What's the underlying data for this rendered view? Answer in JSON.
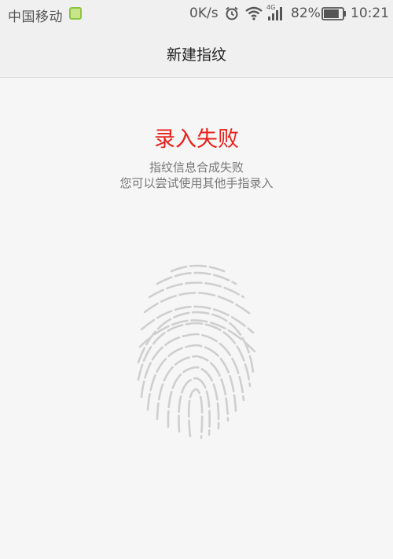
{
  "status_bar": {
    "carrier": "中国移动",
    "net_speed": "0K/s",
    "network_type": "4G",
    "battery": "82%",
    "battery_level": 0.82,
    "time": "10:21",
    "icons": [
      "sim-icon",
      "alarm-icon",
      "wifi-icon",
      "signal-icon",
      "battery-icon"
    ]
  },
  "header": {
    "title": "新建指纹"
  },
  "result": {
    "headline": "录入失败",
    "message_line1": "指纹信息合成失败",
    "message_line2": "您可以尝试使用其他手指录入"
  },
  "colors": {
    "error": "#e8211a",
    "fingerprint": "#cfcfcf",
    "background": "#f6f6f6"
  },
  "illustration": {
    "icon": "fingerprint-icon"
  }
}
